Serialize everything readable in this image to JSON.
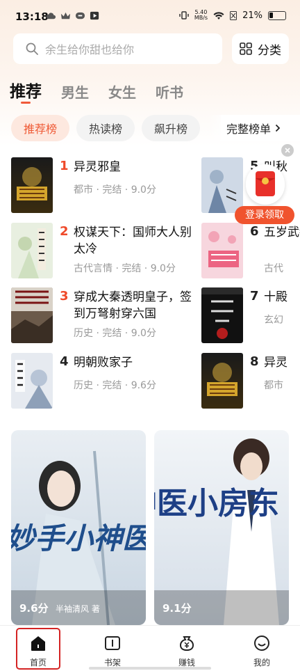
{
  "status_bar": {
    "time": "13:18",
    "speed_value": "5.40",
    "speed_unit": "MB/s",
    "battery": "21%"
  },
  "search": {
    "placeholder": "余生给你甜也给你"
  },
  "category_button": {
    "label": "分类",
    "icon": "grid-icon"
  },
  "tabs": [
    {
      "label": "推荐",
      "active": true
    },
    {
      "label": "男生",
      "active": false
    },
    {
      "label": "女生",
      "active": false
    },
    {
      "label": "听书",
      "active": false
    }
  ],
  "chips": [
    {
      "label": "推荐榜",
      "active": true
    },
    {
      "label": "热读榜",
      "active": false
    },
    {
      "label": "飙升榜",
      "active": false
    }
  ],
  "full_list_label": "完整榜单",
  "ranking_left": [
    {
      "num": "1",
      "title": "异灵邪皇",
      "meta": "都市 · 完结 · 9.0分",
      "num_color": "#ef4a2a"
    },
    {
      "num": "2",
      "title": "权谋天下：国师大人别太冷",
      "meta": "古代言情 · 完结 · 9.0分",
      "num_color": "#ef4a2a"
    },
    {
      "num": "3",
      "title": "穿成大秦透明皇子，签到万弩射穿六国",
      "meta": "历史 · 完结 · 9.0分",
      "num_color": "#ef4a2a"
    },
    {
      "num": "4",
      "title": "明朝败家子",
      "meta": "历史 · 完结 · 9.6分",
      "num_color": "#222222"
    }
  ],
  "ranking_right": [
    {
      "num": "5",
      "title": "叫秋",
      "meta": ""
    },
    {
      "num": "6",
      "title": "五岁武都",
      "meta": "古代"
    },
    {
      "num": "7",
      "title": "十殿",
      "meta": "玄幻"
    },
    {
      "num": "8",
      "title": "异灵",
      "meta": "都市"
    }
  ],
  "promo": {
    "label": "登录领取"
  },
  "cards": [
    {
      "score": "9.6分",
      "author": "半袖清风 著",
      "cover_text": "妙手小神医"
    },
    {
      "score": "9.1分",
      "author": "",
      "cover_text": "神医小房东"
    }
  ],
  "bottom_nav": [
    {
      "label": "首页",
      "icon": "home-icon",
      "active": true
    },
    {
      "label": "书架",
      "icon": "bookshelf-icon",
      "active": false
    },
    {
      "label": "赚钱",
      "icon": "money-bag-icon",
      "active": false
    },
    {
      "label": "我的",
      "icon": "profile-icon",
      "active": false
    }
  ],
  "colors": {
    "accent": "#ef5a36",
    "rank_top": "#ef4a2a"
  }
}
